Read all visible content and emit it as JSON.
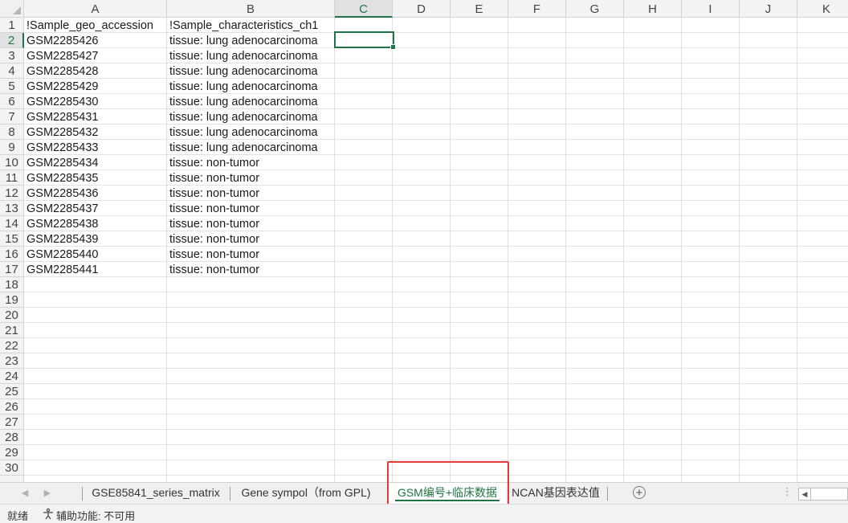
{
  "columns": [
    "A",
    "B",
    "C",
    "D",
    "E",
    "F",
    "G",
    "H",
    "I",
    "J",
    "K"
  ],
  "active_cell": "C2",
  "row_numbers": [
    "1",
    "2",
    "3",
    "4",
    "5",
    "6",
    "7",
    "8",
    "9",
    "10",
    "11",
    "12",
    "13",
    "14",
    "15",
    "16",
    "17",
    "18",
    "19",
    "20",
    "21",
    "22",
    "23",
    "24",
    "25",
    "26",
    "27",
    "28",
    "29",
    "30"
  ],
  "rows": [
    [
      "!Sample_geo_accession",
      "!Sample_characteristics_ch1"
    ],
    [
      "GSM2285426",
      "tissue: lung adenocarcinoma"
    ],
    [
      "GSM2285427",
      "tissue: lung adenocarcinoma"
    ],
    [
      "GSM2285428",
      "tissue: lung adenocarcinoma"
    ],
    [
      "GSM2285429",
      "tissue: lung adenocarcinoma"
    ],
    [
      "GSM2285430",
      "tissue: lung adenocarcinoma"
    ],
    [
      "GSM2285431",
      "tissue: lung adenocarcinoma"
    ],
    [
      "GSM2285432",
      "tissue: lung adenocarcinoma"
    ],
    [
      "GSM2285433",
      "tissue: lung adenocarcinoma"
    ],
    [
      "GSM2285434",
      "tissue: non-tumor"
    ],
    [
      "GSM2285435",
      "tissue: non-tumor"
    ],
    [
      "GSM2285436",
      "tissue: non-tumor"
    ],
    [
      "GSM2285437",
      "tissue: non-tumor"
    ],
    [
      "GSM2285438",
      "tissue: non-tumor"
    ],
    [
      "GSM2285439",
      "tissue: non-tumor"
    ],
    [
      "GSM2285440",
      "tissue: non-tumor"
    ],
    [
      "GSM2285441",
      "tissue: non-tumor"
    ]
  ],
  "sheet_tabs": [
    {
      "label": "GSE85841_series_matrix",
      "active": false
    },
    {
      "label": "Gene sympol（from GPL)",
      "active": false
    },
    {
      "label": "GSM编号+临床数据",
      "active": true
    },
    {
      "label": "NCAN基因表达值",
      "active": false
    }
  ],
  "status": {
    "ready": "就绪",
    "accessibility": "辅助功能: 不可用"
  },
  "icons": {
    "add_sheet": "plus-circle-icon",
    "accessibility": "accessibility-icon",
    "nav_prev": "chevron-left-icon",
    "nav_next": "chevron-right-icon"
  },
  "colors": {
    "accent": "#217346",
    "highlight": "#e53935"
  }
}
